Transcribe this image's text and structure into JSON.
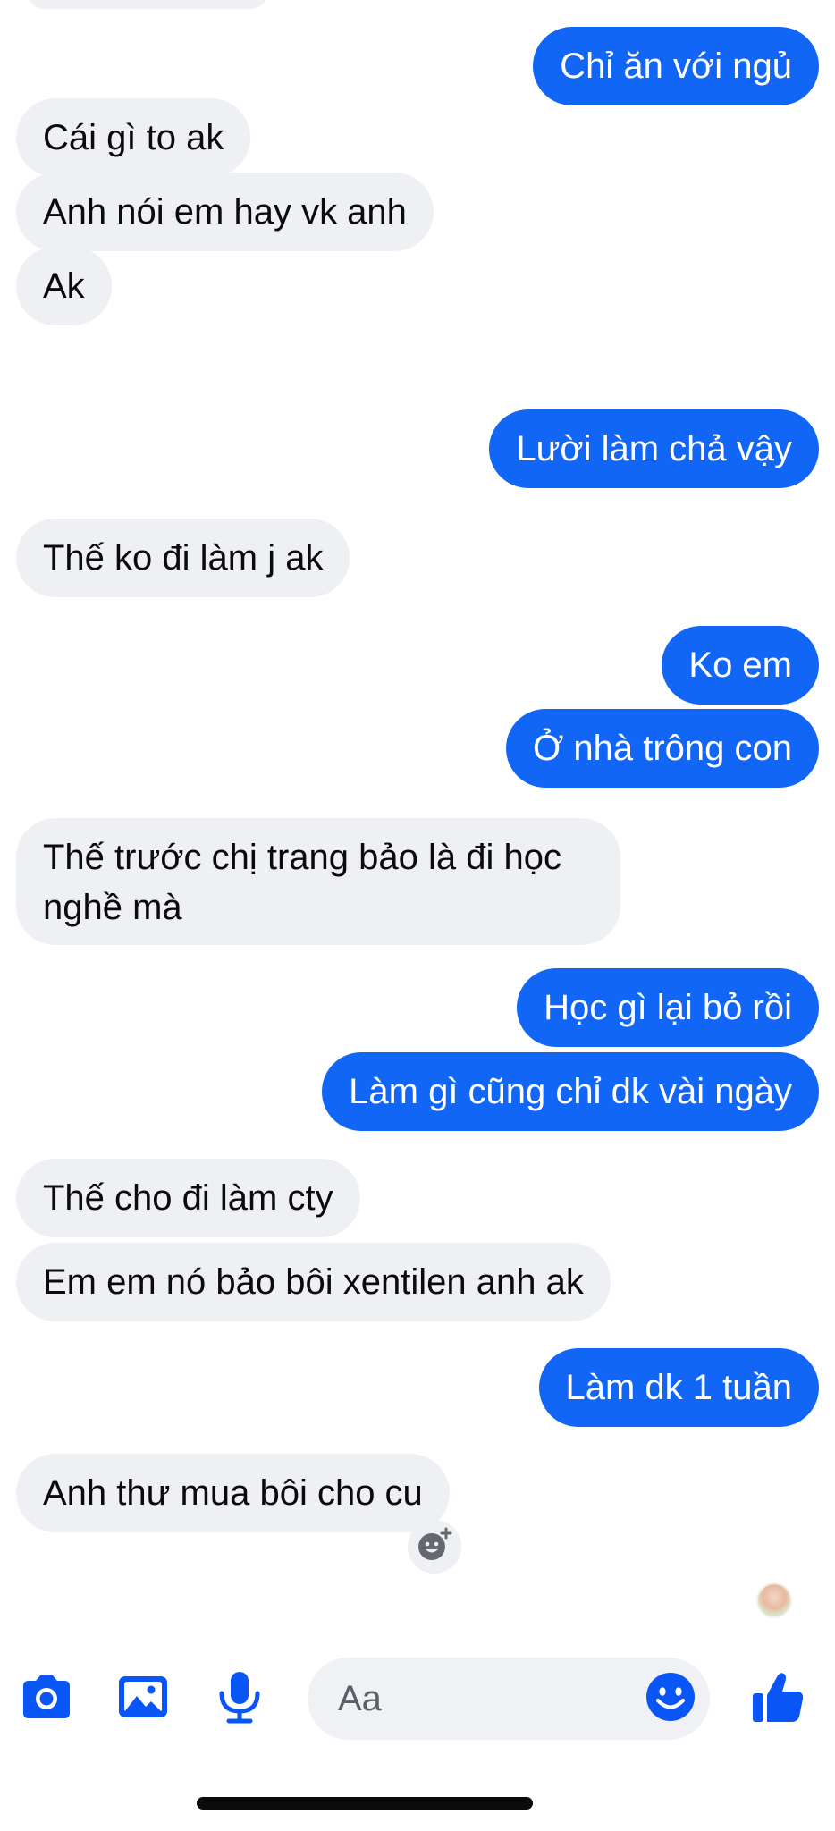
{
  "colors": {
    "outgoing_bubble": "#1166f6",
    "incoming_bubble": "#eef0f3",
    "accent": "#0a55f5"
  },
  "messages": [
    {
      "side": "out",
      "text": "Chỉ ăn với ngủ"
    },
    {
      "side": "in",
      "text": "Cái gì to ak"
    },
    {
      "side": "in",
      "text": "Anh nói em hay vk anh"
    },
    {
      "side": "in",
      "text": "Ak"
    },
    {
      "side": "out",
      "text": "Lười làm chả vậy"
    },
    {
      "side": "in",
      "text": "Thế ko đi làm j ak"
    },
    {
      "side": "out",
      "text": "Ko em"
    },
    {
      "side": "out",
      "text": "Ở nhà trông con"
    },
    {
      "side": "in",
      "text": "Thế trước chị trang bảo là đi học nghề mà"
    },
    {
      "side": "out",
      "text": "Học gì lại bỏ rồi"
    },
    {
      "side": "out",
      "text": "Làm gì cũng chỉ dk vài ngày"
    },
    {
      "side": "in",
      "text": "Thế cho đi làm cty"
    },
    {
      "side": "in",
      "text": "Em em nó bảo bôi xentilen anh ak"
    },
    {
      "side": "out",
      "text": "Làm dk 1 tuần"
    },
    {
      "side": "in",
      "text": "Anh thư mua bôi cho cu"
    }
  ],
  "composer": {
    "placeholder": "Aa",
    "icons": {
      "camera": "camera-icon",
      "gallery": "image-gallery-icon",
      "mic": "microphone-icon",
      "emoji": "emoji-icon",
      "like": "thumbs-up-icon"
    }
  }
}
